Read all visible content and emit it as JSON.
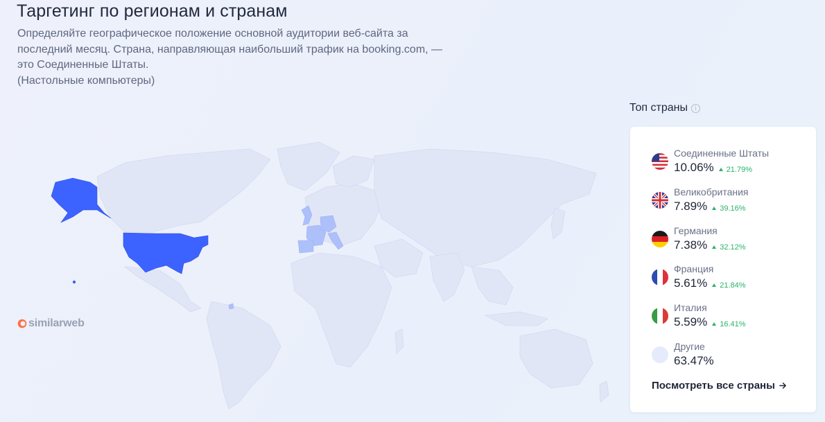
{
  "header": {
    "title": "Таргетинг по регионам и странам",
    "description_line1": "Определяйте географическое положение основной аудитории веб-сайта за",
    "description_line2": "последний месяц. Страна, направляющая наибольший трафик на booking.com, —",
    "description_line3": "это Соединенные Штаты.",
    "description_line4": "(Настольные компьютеры)"
  },
  "brand": {
    "logo_text": "similarweb",
    "logo_color": "#ff7144"
  },
  "map": {
    "highlight_primary": "#3c62ff",
    "highlight_secondary": "#aec0fa",
    "land_color": "#e1e6f7",
    "highlighted_countries": [
      "Соединенные Штаты",
      "Великобритания",
      "Германия",
      "Франция",
      "Италия"
    ]
  },
  "top_countries": {
    "label": "Топ страны",
    "info_icon": "i",
    "items": [
      {
        "name": "Соединенные Штаты",
        "share": "10.06%",
        "change": "21.79%",
        "trend": "up",
        "flag": "us-flag-icon"
      },
      {
        "name": "Великобритания",
        "share": "7.89%",
        "change": "39.16%",
        "trend": "up",
        "flag": "uk-flag-icon"
      },
      {
        "name": "Германия",
        "share": "7.38%",
        "change": "32.12%",
        "trend": "up",
        "flag": "de-flag-icon"
      },
      {
        "name": "Франция",
        "share": "5.61%",
        "change": "21.84%",
        "trend": "up",
        "flag": "fr-flag-icon"
      },
      {
        "name": "Италия",
        "share": "5.59%",
        "change": "16.41%",
        "trend": "up",
        "flag": "it-flag-icon"
      }
    ],
    "other": {
      "name": "Другие",
      "share": "63.47%"
    },
    "see_all_label": "Посмотреть все страны",
    "positive_color": "#29b36b"
  }
}
